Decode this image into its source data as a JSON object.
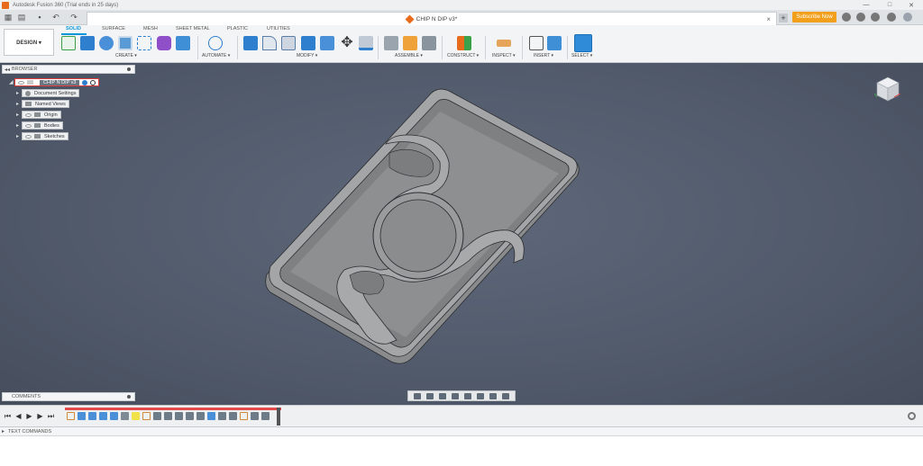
{
  "window": {
    "title": "Autodesk Fusion 360 (Trial ends in 25 days)"
  },
  "document": {
    "tab_title": "CHIP N DIP v3*",
    "close_glyph": "×"
  },
  "header": {
    "subscribe_label": "Subscribe Now",
    "new_tab_glyph": "+"
  },
  "workspace": {
    "design_label": "DESIGN ▾",
    "tabs": [
      "SOLID",
      "SURFACE",
      "MESH",
      "SHEET METAL",
      "PLASTIC",
      "UTILITIES"
    ],
    "active_tab": "SOLID"
  },
  "toolbar_groups": {
    "create": "CREATE ▾",
    "automate": "AUTOMATE ▾",
    "modify": "MODIFY ▾",
    "assemble": "ASSEMBLE ▾",
    "construct": "CONSTRUCT ▾",
    "inspect": "INSPECT ▾",
    "insert": "INSERT ▾",
    "select": "SELECT ▾"
  },
  "browser": {
    "title": "BROWSER",
    "root": "CHIP N DIP v3",
    "items": [
      "Document Settings",
      "Named Views",
      "Origin",
      "Bodies",
      "Sketches"
    ]
  },
  "comments": {
    "title": "COMMENTS"
  },
  "text_commands": {
    "title": "TEXT COMMANDS"
  },
  "colors": {
    "accent": "#0696d7",
    "subscribe": "#f2a01c",
    "timeline_track": "#e34b4b"
  }
}
